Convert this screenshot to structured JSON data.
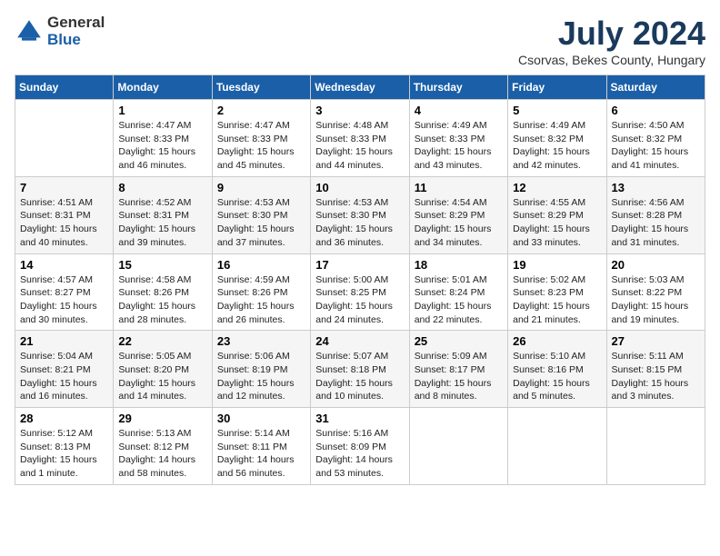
{
  "header": {
    "logo": {
      "general": "General",
      "blue": "Blue",
      "icon": "▶"
    },
    "title": "July 2024",
    "location": "Csorvas, Bekes County, Hungary"
  },
  "days_of_week": [
    "Sunday",
    "Monday",
    "Tuesday",
    "Wednesday",
    "Thursday",
    "Friday",
    "Saturday"
  ],
  "weeks": [
    [
      {
        "day": "",
        "info": ""
      },
      {
        "day": "1",
        "info": "Sunrise: 4:47 AM\nSunset: 8:33 PM\nDaylight: 15 hours\nand 46 minutes."
      },
      {
        "day": "2",
        "info": "Sunrise: 4:47 AM\nSunset: 8:33 PM\nDaylight: 15 hours\nand 45 minutes."
      },
      {
        "day": "3",
        "info": "Sunrise: 4:48 AM\nSunset: 8:33 PM\nDaylight: 15 hours\nand 44 minutes."
      },
      {
        "day": "4",
        "info": "Sunrise: 4:49 AM\nSunset: 8:33 PM\nDaylight: 15 hours\nand 43 minutes."
      },
      {
        "day": "5",
        "info": "Sunrise: 4:49 AM\nSunset: 8:32 PM\nDaylight: 15 hours\nand 42 minutes."
      },
      {
        "day": "6",
        "info": "Sunrise: 4:50 AM\nSunset: 8:32 PM\nDaylight: 15 hours\nand 41 minutes."
      }
    ],
    [
      {
        "day": "7",
        "info": "Sunrise: 4:51 AM\nSunset: 8:31 PM\nDaylight: 15 hours\nand 40 minutes."
      },
      {
        "day": "8",
        "info": "Sunrise: 4:52 AM\nSunset: 8:31 PM\nDaylight: 15 hours\nand 39 minutes."
      },
      {
        "day": "9",
        "info": "Sunrise: 4:53 AM\nSunset: 8:30 PM\nDaylight: 15 hours\nand 37 minutes."
      },
      {
        "day": "10",
        "info": "Sunrise: 4:53 AM\nSunset: 8:30 PM\nDaylight: 15 hours\nand 36 minutes."
      },
      {
        "day": "11",
        "info": "Sunrise: 4:54 AM\nSunset: 8:29 PM\nDaylight: 15 hours\nand 34 minutes."
      },
      {
        "day": "12",
        "info": "Sunrise: 4:55 AM\nSunset: 8:29 PM\nDaylight: 15 hours\nand 33 minutes."
      },
      {
        "day": "13",
        "info": "Sunrise: 4:56 AM\nSunset: 8:28 PM\nDaylight: 15 hours\nand 31 minutes."
      }
    ],
    [
      {
        "day": "14",
        "info": "Sunrise: 4:57 AM\nSunset: 8:27 PM\nDaylight: 15 hours\nand 30 minutes."
      },
      {
        "day": "15",
        "info": "Sunrise: 4:58 AM\nSunset: 8:26 PM\nDaylight: 15 hours\nand 28 minutes."
      },
      {
        "day": "16",
        "info": "Sunrise: 4:59 AM\nSunset: 8:26 PM\nDaylight: 15 hours\nand 26 minutes."
      },
      {
        "day": "17",
        "info": "Sunrise: 5:00 AM\nSunset: 8:25 PM\nDaylight: 15 hours\nand 24 minutes."
      },
      {
        "day": "18",
        "info": "Sunrise: 5:01 AM\nSunset: 8:24 PM\nDaylight: 15 hours\nand 22 minutes."
      },
      {
        "day": "19",
        "info": "Sunrise: 5:02 AM\nSunset: 8:23 PM\nDaylight: 15 hours\nand 21 minutes."
      },
      {
        "day": "20",
        "info": "Sunrise: 5:03 AM\nSunset: 8:22 PM\nDaylight: 15 hours\nand 19 minutes."
      }
    ],
    [
      {
        "day": "21",
        "info": "Sunrise: 5:04 AM\nSunset: 8:21 PM\nDaylight: 15 hours\nand 16 minutes."
      },
      {
        "day": "22",
        "info": "Sunrise: 5:05 AM\nSunset: 8:20 PM\nDaylight: 15 hours\nand 14 minutes."
      },
      {
        "day": "23",
        "info": "Sunrise: 5:06 AM\nSunset: 8:19 PM\nDaylight: 15 hours\nand 12 minutes."
      },
      {
        "day": "24",
        "info": "Sunrise: 5:07 AM\nSunset: 8:18 PM\nDaylight: 15 hours\nand 10 minutes."
      },
      {
        "day": "25",
        "info": "Sunrise: 5:09 AM\nSunset: 8:17 PM\nDaylight: 15 hours\nand 8 minutes."
      },
      {
        "day": "26",
        "info": "Sunrise: 5:10 AM\nSunset: 8:16 PM\nDaylight: 15 hours\nand 5 minutes."
      },
      {
        "day": "27",
        "info": "Sunrise: 5:11 AM\nSunset: 8:15 PM\nDaylight: 15 hours\nand 3 minutes."
      }
    ],
    [
      {
        "day": "28",
        "info": "Sunrise: 5:12 AM\nSunset: 8:13 PM\nDaylight: 15 hours\nand 1 minute."
      },
      {
        "day": "29",
        "info": "Sunrise: 5:13 AM\nSunset: 8:12 PM\nDaylight: 14 hours\nand 58 minutes."
      },
      {
        "day": "30",
        "info": "Sunrise: 5:14 AM\nSunset: 8:11 PM\nDaylight: 14 hours\nand 56 minutes."
      },
      {
        "day": "31",
        "info": "Sunrise: 5:16 AM\nSunset: 8:09 PM\nDaylight: 14 hours\nand 53 minutes."
      },
      {
        "day": "",
        "info": ""
      },
      {
        "day": "",
        "info": ""
      },
      {
        "day": "",
        "info": ""
      }
    ]
  ]
}
